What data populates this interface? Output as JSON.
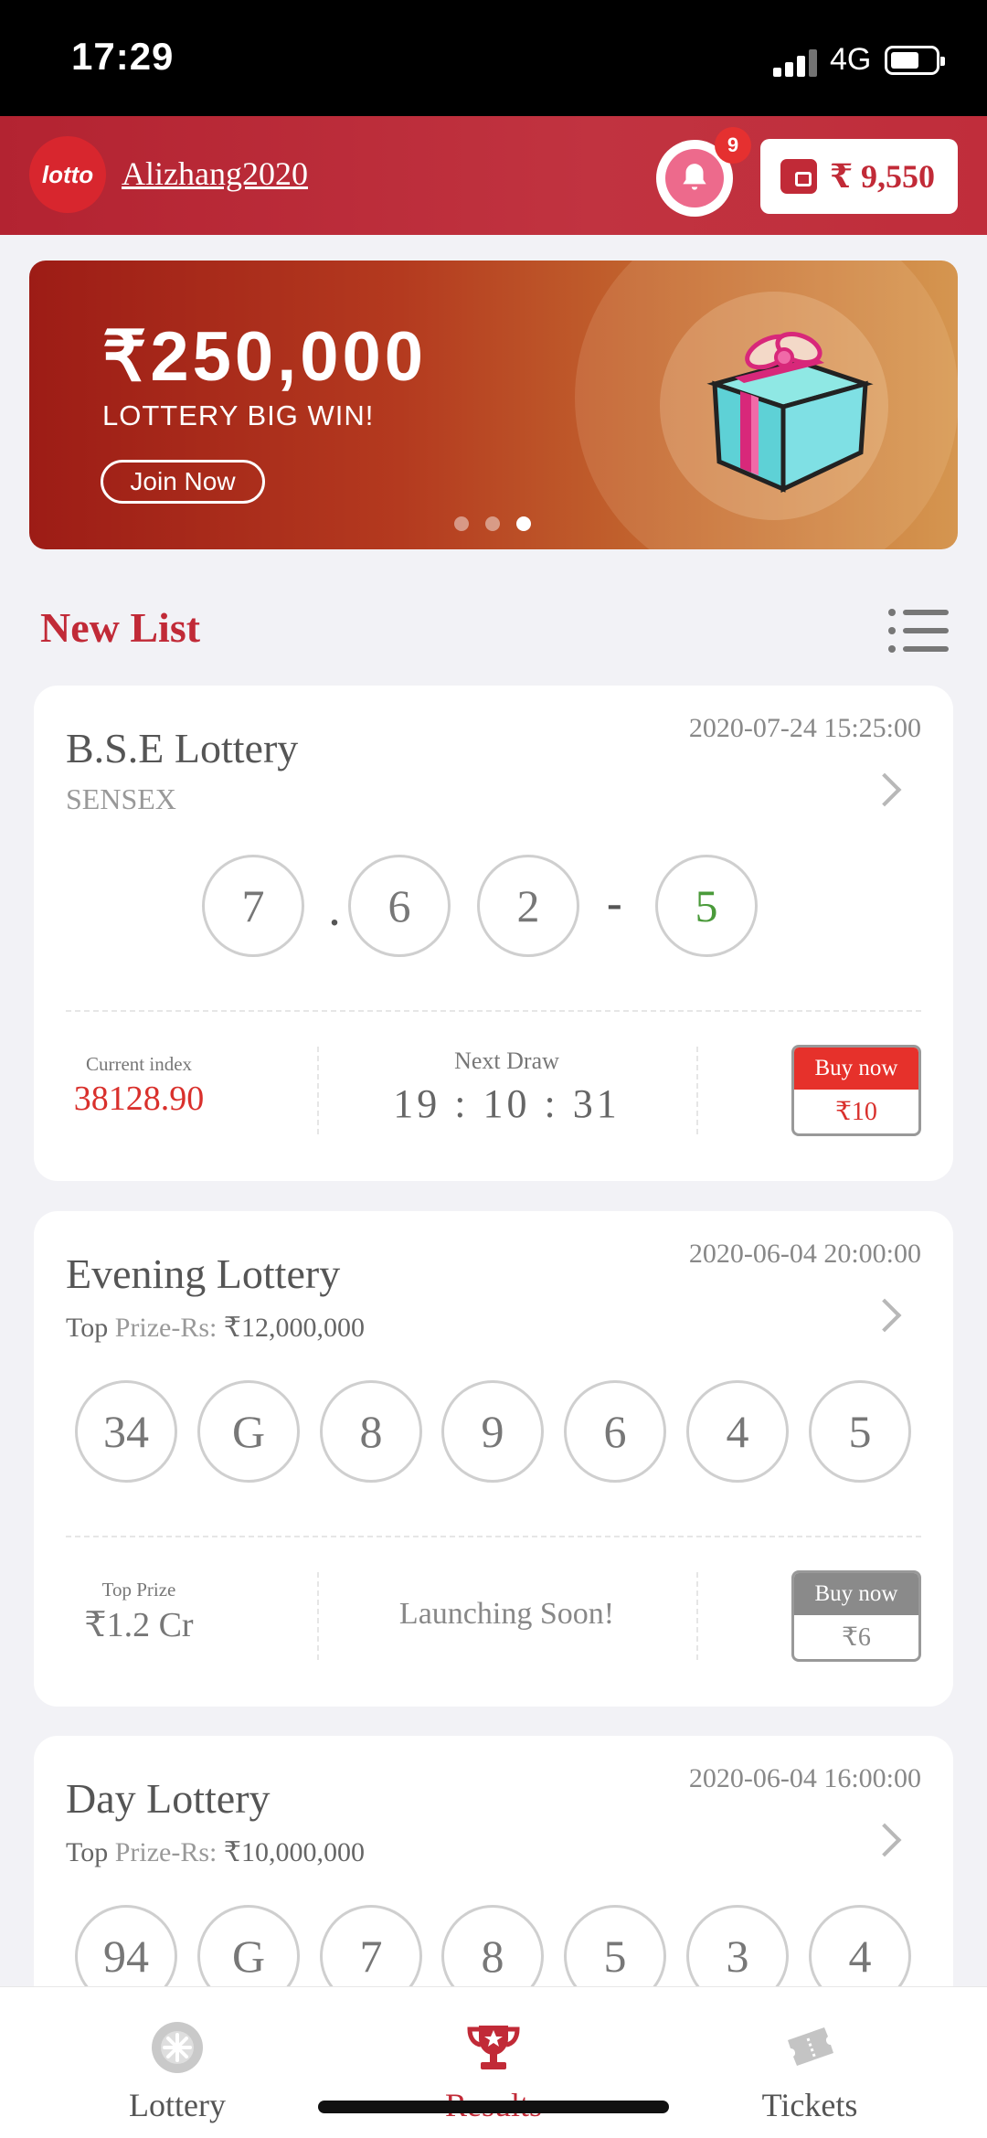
{
  "status_bar": {
    "time": "17:29",
    "network": "4G"
  },
  "header": {
    "logo_text": "lotto",
    "username": "Alizhang2020",
    "notification_count": "9",
    "wallet_balance": "₹ 9,550"
  },
  "banner": {
    "amount": "₹250,000",
    "subtitle": "LOTTERY BIG WIN!",
    "cta": "Join Now",
    "slides": 3,
    "active_slide": 3
  },
  "section": {
    "title": "New List"
  },
  "cards": [
    {
      "title": "B.S.E Lottery",
      "subtitle": "SENSEX",
      "date": "2020-07-24 15:25:00",
      "balls": [
        "7",
        "6",
        "2",
        "5"
      ],
      "separators": [
        ".",
        "-"
      ],
      "stat_label": "Current index",
      "stat_value": "38128.90",
      "next_label": "Next Draw",
      "countdown": [
        "19",
        "10",
        "31"
      ],
      "buy_label": "Buy now",
      "buy_price": "₹10"
    },
    {
      "title": "Evening Lottery",
      "subtitle_prefix": "Top",
      "subtitle_mid": "Prize-Rs:",
      "subtitle_value": "₹12,000,000",
      "date": "2020-06-04 20:00:00",
      "balls": [
        "34",
        "G",
        "8",
        "9",
        "6",
        "4",
        "5"
      ],
      "stat_label": "Top Prize",
      "stat_value": "₹1.2 Cr",
      "status": "Launching Soon!",
      "buy_label": "Buy now",
      "buy_price": "₹6"
    },
    {
      "title": "Day Lottery",
      "subtitle_prefix": "Top",
      "subtitle_mid": "Prize-Rs:",
      "subtitle_value": "₹10,000,000",
      "date": "2020-06-04 16:00:00",
      "balls": [
        "94",
        "G",
        "7",
        "8",
        "5",
        "3",
        "4"
      ]
    }
  ],
  "tabs": [
    {
      "label": "Lottery",
      "icon": "lottery-icon"
    },
    {
      "label": "Results",
      "icon": "trophy-icon",
      "active": true
    },
    {
      "label": "Tickets",
      "icon": "ticket-icon"
    }
  ],
  "colors": {
    "brand_red": "#c12a37",
    "accent_green": "#4a9a3a",
    "buy_red": "#e6312b"
  }
}
